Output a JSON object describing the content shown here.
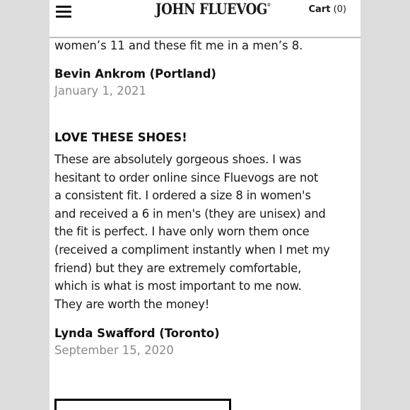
{
  "header": {
    "logo_text": "John Fluevog",
    "logo_mark": "®",
    "cart_label": "Cart",
    "cart_count": "(0)"
  },
  "reviews": [
    {
      "body_tail": "women’s 11 and these fit me in a men’s 8.",
      "author": "Bevin Ankrom (Portland)",
      "date": "January 1, 2021"
    },
    {
      "title": "LOVE THESE SHOES!",
      "body": "These are absolutely gorgeous shoes. I was\nhesitant to order online since Fluevogs are not\na consistent fit. I ordered a size 8 in women's\nand received a 6 in men's (they are unisex) and\nthe fit is perfect. I have only worn them once\n(received a compliment instantly when I met my\nfriend) but they are extremely comfortable,\nwhich is what is most important to me now.\nThey are worth the money!",
      "author": "Lynda Swafford (Toronto)",
      "date": "September 15, 2020"
    }
  ],
  "icons": {
    "menu": "hamburger-menu-icon"
  }
}
